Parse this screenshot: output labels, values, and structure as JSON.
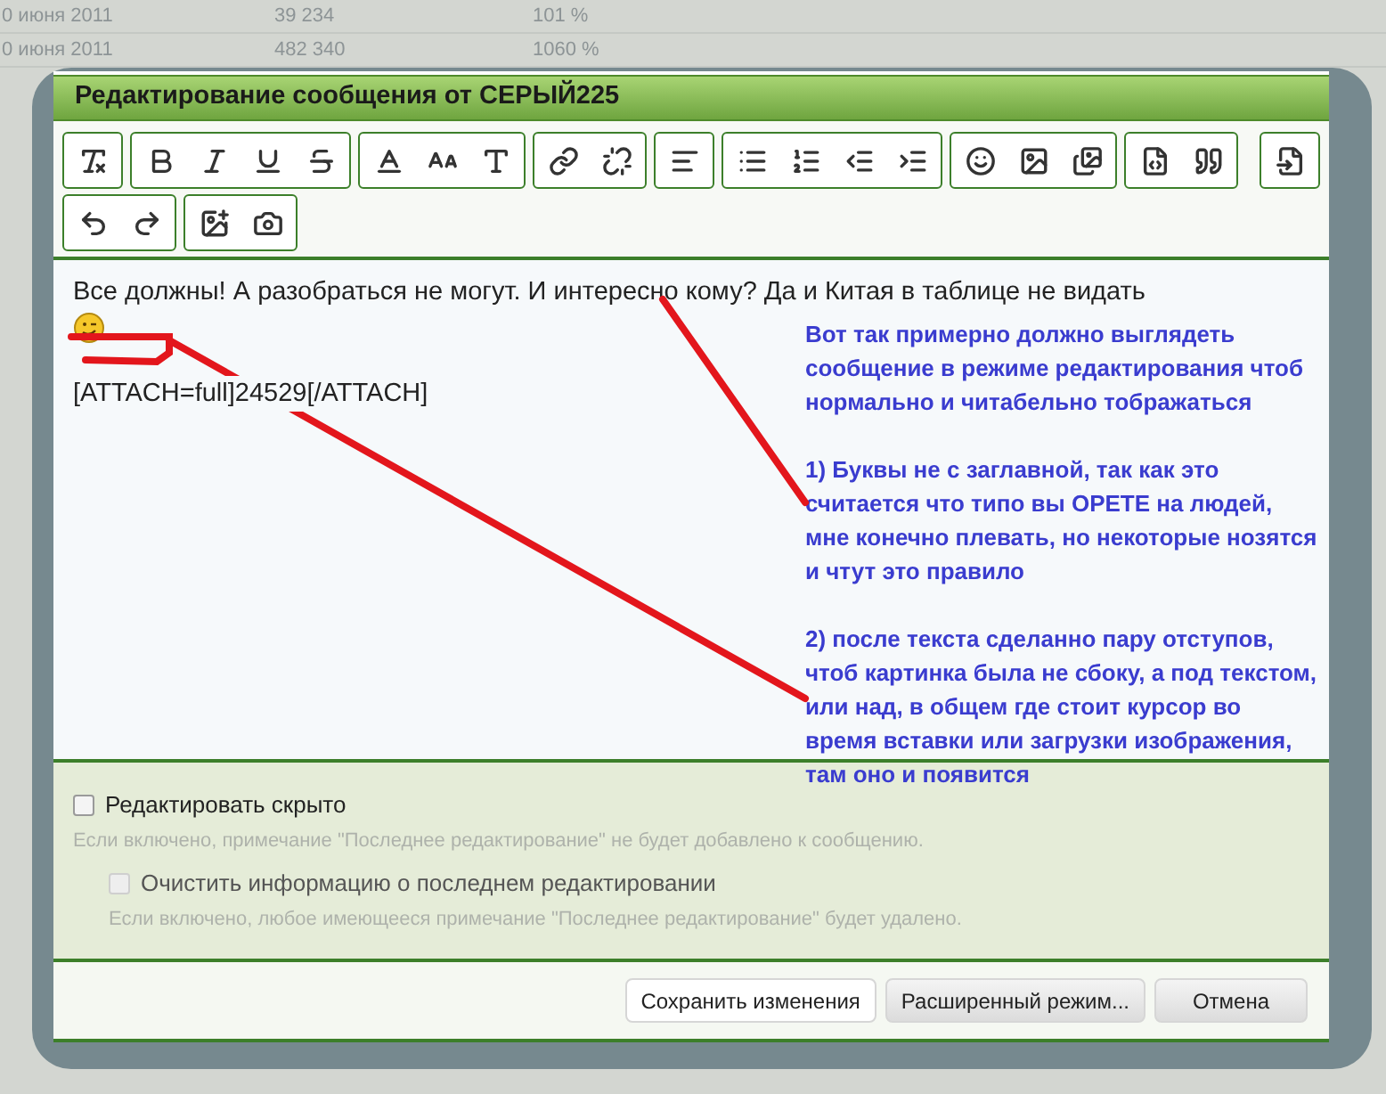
{
  "background_rows": [
    {
      "date": "0 июня 2011",
      "value": "39 234",
      "percent": "101 %"
    },
    {
      "date": "0 июня 2011",
      "value": "482 340",
      "percent": "1060 %"
    }
  ],
  "dialog": {
    "title": "Редактирование сообщения от СЕРЫЙ225"
  },
  "editor": {
    "text": "Все должны! А разобраться не могут. И интересно кому? Да и Китая в таблице не видать",
    "attachment": "[ATTACH=full]24529[/ATTACH]"
  },
  "annotation": {
    "paragraphs": [
      "Вот так примерно должно выглядеть сообщение в режиме редактирования чтоб нормально и читабельно тображаться",
      "1) Буквы не с заглавной, так как это считается что типо вы ОРЕТЕ на людей, мне конечно плевать, но некоторые нозятся и чтут это правило",
      "2) после текста сделанно пару отступов, чтоб картинка была не сбоку, а под текстом, или над, в общем где стоит курсор во время вставки или загрузки изображения, там оно и появится"
    ]
  },
  "options": [
    {
      "label": "Редактировать скрыто",
      "hint": "Если включено, примечание \"Последнее редактирование\" не будет добавлено к сообщению.",
      "checked": false,
      "disabled": false,
      "nested": false
    },
    {
      "label": "Очистить информацию о последнем редактировании",
      "hint": "Если включено, любое имеющееся примечание \"Последнее редактирование\" будет удалено.",
      "checked": false,
      "disabled": true,
      "nested": true
    }
  ],
  "buttons": [
    {
      "label": "Сохранить изменения",
      "kind": "primary"
    },
    {
      "label": "Расширенный режим...",
      "kind": "secondary"
    },
    {
      "label": "Отмена",
      "kind": "secondary"
    }
  ]
}
